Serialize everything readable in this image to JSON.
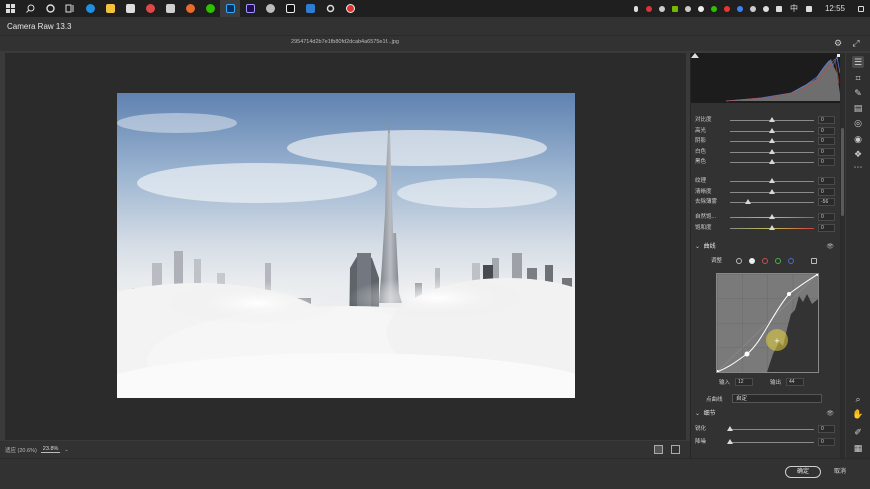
{
  "taskbar": {
    "icons": [
      "windows-icon",
      "search-icon",
      "cortana-icon",
      "task-view-icon",
      "edge-icon",
      "file-explorer-icon",
      "store-icon",
      "app-icon",
      "app-icon",
      "app-icon",
      "wechat-icon",
      "photoshop-icon",
      "premiere-icon",
      "app-icon",
      "app-icon",
      "photos-icon",
      "settings-icon",
      "record-icon"
    ],
    "time": "12:55",
    "ime": "中"
  },
  "app_title": "Camera Raw 13.3",
  "file_name": "2954714d2b7e1fb80fd2dcab4a6575e1f...jpg",
  "bottom": {
    "fit_label": "适应 (20.6%)",
    "zoom_value": "23.8%"
  },
  "dialog": {
    "ok_label": "确定",
    "cancel_label": "取消"
  },
  "panel": {
    "basic_sliders": [
      {
        "label": "对比度",
        "value": "0",
        "pos": 0.5
      },
      {
        "label": "高光",
        "value": "0",
        "pos": 0.5
      },
      {
        "label": "阴影",
        "value": "0",
        "pos": 0.5
      },
      {
        "label": "白色",
        "value": "0",
        "pos": 0.5
      },
      {
        "label": "黑色",
        "value": "0",
        "pos": 0.5
      }
    ],
    "presence_sliders": [
      {
        "label": "纹理",
        "value": "0",
        "pos": 0.5
      },
      {
        "label": "清晰度",
        "value": "0",
        "pos": 0.5
      },
      {
        "label": "去除薄雾",
        "value": "-56",
        "pos": 0.22
      }
    ],
    "color_sliders": [
      {
        "label": "自然饱...",
        "value": "0",
        "pos": 0.5
      },
      {
        "label": "饱和度",
        "value": "0",
        "pos": 0.5
      }
    ],
    "curve": {
      "title": "曲线",
      "adjust_label": "调整",
      "input_label": "输入",
      "input_value": "12",
      "output_label": "输出",
      "output_value": "44",
      "point_curve_label": "点曲线",
      "point_curve_value": "自定"
    },
    "detail": {
      "title": "细节",
      "sliders": [
        {
          "label": "锐化",
          "value": "0",
          "pos": 0.0
        },
        {
          "label": "降噪",
          "value": "0",
          "pos": 0.0
        }
      ]
    }
  }
}
